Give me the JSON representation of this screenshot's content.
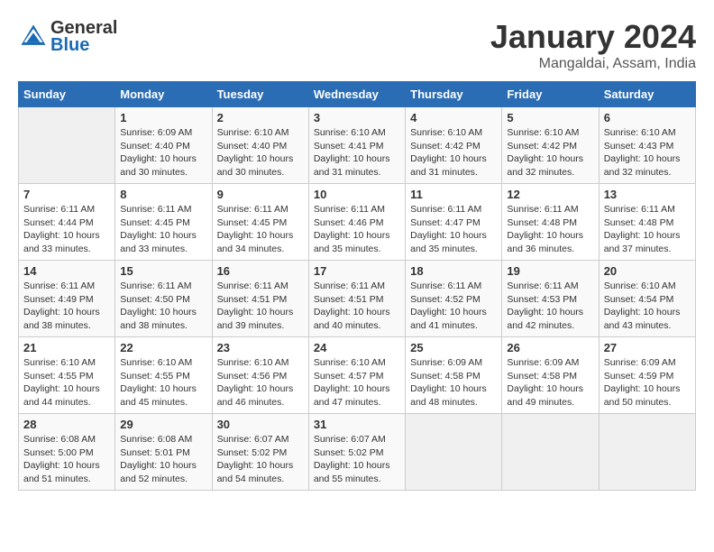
{
  "header": {
    "logo_line1": "General",
    "logo_line2": "Blue",
    "month": "January 2024",
    "location": "Mangaldai, Assam, India"
  },
  "weekdays": [
    "Sunday",
    "Monday",
    "Tuesday",
    "Wednesday",
    "Thursday",
    "Friday",
    "Saturday"
  ],
  "weeks": [
    [
      {
        "day": "",
        "sunrise": "",
        "sunset": "",
        "daylight": ""
      },
      {
        "day": "1",
        "sunrise": "Sunrise: 6:09 AM",
        "sunset": "Sunset: 4:40 PM",
        "daylight": "Daylight: 10 hours and 30 minutes."
      },
      {
        "day": "2",
        "sunrise": "Sunrise: 6:10 AM",
        "sunset": "Sunset: 4:40 PM",
        "daylight": "Daylight: 10 hours and 30 minutes."
      },
      {
        "day": "3",
        "sunrise": "Sunrise: 6:10 AM",
        "sunset": "Sunset: 4:41 PM",
        "daylight": "Daylight: 10 hours and 31 minutes."
      },
      {
        "day": "4",
        "sunrise": "Sunrise: 6:10 AM",
        "sunset": "Sunset: 4:42 PM",
        "daylight": "Daylight: 10 hours and 31 minutes."
      },
      {
        "day": "5",
        "sunrise": "Sunrise: 6:10 AM",
        "sunset": "Sunset: 4:42 PM",
        "daylight": "Daylight: 10 hours and 32 minutes."
      },
      {
        "day": "6",
        "sunrise": "Sunrise: 6:10 AM",
        "sunset": "Sunset: 4:43 PM",
        "daylight": "Daylight: 10 hours and 32 minutes."
      }
    ],
    [
      {
        "day": "7",
        "sunrise": "Sunrise: 6:11 AM",
        "sunset": "Sunset: 4:44 PM",
        "daylight": "Daylight: 10 hours and 33 minutes."
      },
      {
        "day": "8",
        "sunrise": "Sunrise: 6:11 AM",
        "sunset": "Sunset: 4:45 PM",
        "daylight": "Daylight: 10 hours and 33 minutes."
      },
      {
        "day": "9",
        "sunrise": "Sunrise: 6:11 AM",
        "sunset": "Sunset: 4:45 PM",
        "daylight": "Daylight: 10 hours and 34 minutes."
      },
      {
        "day": "10",
        "sunrise": "Sunrise: 6:11 AM",
        "sunset": "Sunset: 4:46 PM",
        "daylight": "Daylight: 10 hours and 35 minutes."
      },
      {
        "day": "11",
        "sunrise": "Sunrise: 6:11 AM",
        "sunset": "Sunset: 4:47 PM",
        "daylight": "Daylight: 10 hours and 35 minutes."
      },
      {
        "day": "12",
        "sunrise": "Sunrise: 6:11 AM",
        "sunset": "Sunset: 4:48 PM",
        "daylight": "Daylight: 10 hours and 36 minutes."
      },
      {
        "day": "13",
        "sunrise": "Sunrise: 6:11 AM",
        "sunset": "Sunset: 4:48 PM",
        "daylight": "Daylight: 10 hours and 37 minutes."
      }
    ],
    [
      {
        "day": "14",
        "sunrise": "Sunrise: 6:11 AM",
        "sunset": "Sunset: 4:49 PM",
        "daylight": "Daylight: 10 hours and 38 minutes."
      },
      {
        "day": "15",
        "sunrise": "Sunrise: 6:11 AM",
        "sunset": "Sunset: 4:50 PM",
        "daylight": "Daylight: 10 hours and 38 minutes."
      },
      {
        "day": "16",
        "sunrise": "Sunrise: 6:11 AM",
        "sunset": "Sunset: 4:51 PM",
        "daylight": "Daylight: 10 hours and 39 minutes."
      },
      {
        "day": "17",
        "sunrise": "Sunrise: 6:11 AM",
        "sunset": "Sunset: 4:51 PM",
        "daylight": "Daylight: 10 hours and 40 minutes."
      },
      {
        "day": "18",
        "sunrise": "Sunrise: 6:11 AM",
        "sunset": "Sunset: 4:52 PM",
        "daylight": "Daylight: 10 hours and 41 minutes."
      },
      {
        "day": "19",
        "sunrise": "Sunrise: 6:11 AM",
        "sunset": "Sunset: 4:53 PM",
        "daylight": "Daylight: 10 hours and 42 minutes."
      },
      {
        "day": "20",
        "sunrise": "Sunrise: 6:10 AM",
        "sunset": "Sunset: 4:54 PM",
        "daylight": "Daylight: 10 hours and 43 minutes."
      }
    ],
    [
      {
        "day": "21",
        "sunrise": "Sunrise: 6:10 AM",
        "sunset": "Sunset: 4:55 PM",
        "daylight": "Daylight: 10 hours and 44 minutes."
      },
      {
        "day": "22",
        "sunrise": "Sunrise: 6:10 AM",
        "sunset": "Sunset: 4:55 PM",
        "daylight": "Daylight: 10 hours and 45 minutes."
      },
      {
        "day": "23",
        "sunrise": "Sunrise: 6:10 AM",
        "sunset": "Sunset: 4:56 PM",
        "daylight": "Daylight: 10 hours and 46 minutes."
      },
      {
        "day": "24",
        "sunrise": "Sunrise: 6:10 AM",
        "sunset": "Sunset: 4:57 PM",
        "daylight": "Daylight: 10 hours and 47 minutes."
      },
      {
        "day": "25",
        "sunrise": "Sunrise: 6:09 AM",
        "sunset": "Sunset: 4:58 PM",
        "daylight": "Daylight: 10 hours and 48 minutes."
      },
      {
        "day": "26",
        "sunrise": "Sunrise: 6:09 AM",
        "sunset": "Sunset: 4:58 PM",
        "daylight": "Daylight: 10 hours and 49 minutes."
      },
      {
        "day": "27",
        "sunrise": "Sunrise: 6:09 AM",
        "sunset": "Sunset: 4:59 PM",
        "daylight": "Daylight: 10 hours and 50 minutes."
      }
    ],
    [
      {
        "day": "28",
        "sunrise": "Sunrise: 6:08 AM",
        "sunset": "Sunset: 5:00 PM",
        "daylight": "Daylight: 10 hours and 51 minutes."
      },
      {
        "day": "29",
        "sunrise": "Sunrise: 6:08 AM",
        "sunset": "Sunset: 5:01 PM",
        "daylight": "Daylight: 10 hours and 52 minutes."
      },
      {
        "day": "30",
        "sunrise": "Sunrise: 6:07 AM",
        "sunset": "Sunset: 5:02 PM",
        "daylight": "Daylight: 10 hours and 54 minutes."
      },
      {
        "day": "31",
        "sunrise": "Sunrise: 6:07 AM",
        "sunset": "Sunset: 5:02 PM",
        "daylight": "Daylight: 10 hours and 55 minutes."
      },
      {
        "day": "",
        "sunrise": "",
        "sunset": "",
        "daylight": ""
      },
      {
        "day": "",
        "sunrise": "",
        "sunset": "",
        "daylight": ""
      },
      {
        "day": "",
        "sunrise": "",
        "sunset": "",
        "daylight": ""
      }
    ]
  ]
}
